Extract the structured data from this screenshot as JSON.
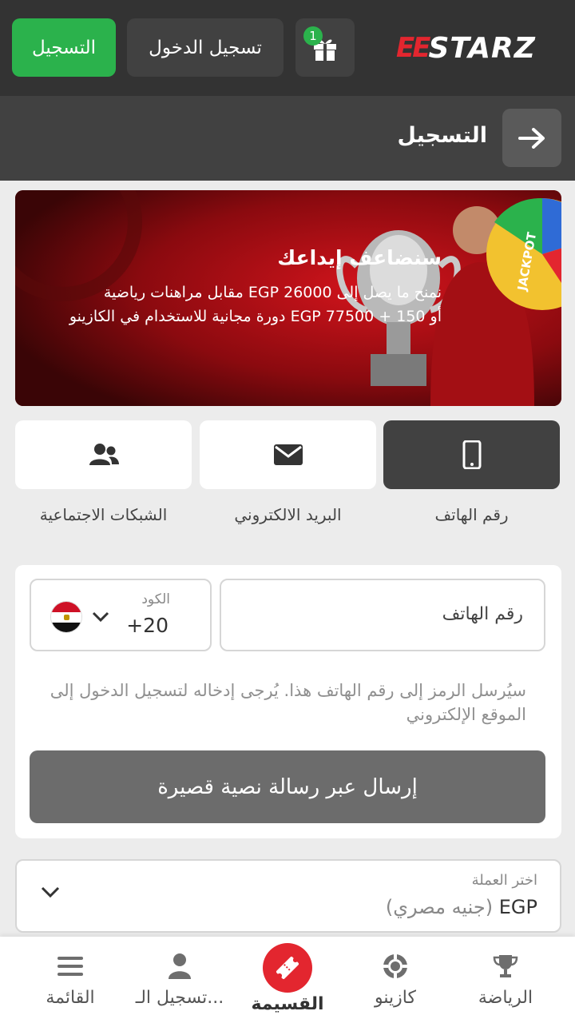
{
  "header": {
    "register_label": "التسجيل",
    "login_label": "تسجيل الدخول",
    "gift_count": "1",
    "logo_mark": "EE",
    "logo_text": "STARZ"
  },
  "titlebar": {
    "title": "التسجيل"
  },
  "banner": {
    "title": "سنضاعف إيداعك",
    "line1": "نمنح ما يصل إلى EGP 26000 مقابل مراهنات رياضية",
    "line2": "أو EGP 77500 + 150 دورة مجانية للاستخدام في الكازينو",
    "jackpot": "JACKPOT"
  },
  "tabs": [
    {
      "label": "رقم الهاتف",
      "icon": "mobile-phone-icon",
      "active": true
    },
    {
      "label": "البريد الالكتروني",
      "icon": "envelope-icon",
      "active": false
    },
    {
      "label": "الشبكات الاجتماعية",
      "icon": "users-icon",
      "active": false
    }
  ],
  "form": {
    "code_label": "الكود",
    "code_value": "+20",
    "country_flag": "egypt-flag",
    "phone_placeholder": "رقم الهاتف",
    "hint": "سيُرسل الرمز إلى رقم الهاتف هذا. يُرجى إدخاله لتسجيل الدخول إلى الموقع الإلكتروني",
    "sms_button": "إرسال عبر رسالة نصية قصيرة"
  },
  "currency": {
    "label": "اختر العملة",
    "code": "EGP",
    "name": "(جنيه مصري)"
  },
  "bottom_nav": [
    {
      "label": "الرياضة",
      "icon": "trophy-icon"
    },
    {
      "label": "كازينو",
      "icon": "casino-chip-icon"
    },
    {
      "label": "القسيمة",
      "icon": "ticket-icon"
    },
    {
      "label": "تسجيل الـ...",
      "icon": "user-icon"
    },
    {
      "label": "القائمة",
      "icon": "hamburger-menu-icon"
    }
  ],
  "colors": {
    "brand_green": "#2bb24c",
    "brand_red": "#e3262f",
    "dark": "#333333"
  }
}
